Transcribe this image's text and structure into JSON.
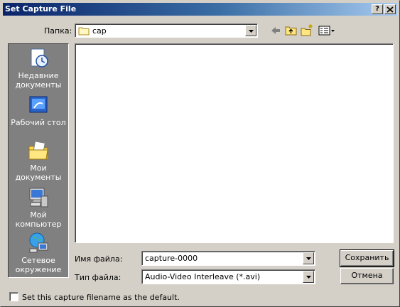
{
  "window": {
    "title": "Set Capture File",
    "help_button": "?",
    "close_button": "X"
  },
  "lookin": {
    "label": "Папка:",
    "value": "cap"
  },
  "places": [
    {
      "label": "Недавние документы",
      "icon": "recent-documents-icon"
    },
    {
      "label": "Рабочий стол",
      "icon": "desktop-icon"
    },
    {
      "label": "Мои документы",
      "icon": "my-documents-icon"
    },
    {
      "label": "Мой компьютер",
      "icon": "my-computer-icon"
    },
    {
      "label": "Сетевое окружение",
      "icon": "network-icon"
    }
  ],
  "filename": {
    "label": "Имя файла:",
    "value": "capture-0000"
  },
  "filetype": {
    "label": "Тип файла:",
    "value": "Audio-Video Interleave (*.avi)"
  },
  "buttons": {
    "save": "Сохранить",
    "cancel": "Отмена"
  },
  "default_checkbox": {
    "label": "Set this capture filename as the default.",
    "checked": false
  }
}
